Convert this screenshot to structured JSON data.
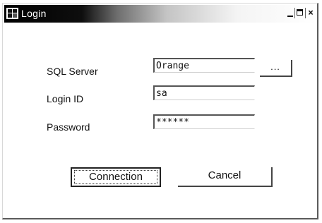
{
  "window": {
    "title": "Login",
    "icon": "app-window-icon",
    "controls": {
      "minimize": "_",
      "close": "×"
    }
  },
  "form": {
    "server_label": "SQL Server",
    "server_value": "Orange",
    "browse_label": "...",
    "login_label": "Login ID",
    "login_value": "sa",
    "password_label": "Password",
    "password_value": "******"
  },
  "actions": {
    "connect_label": "Connection",
    "cancel_label": "Cancel"
  }
}
